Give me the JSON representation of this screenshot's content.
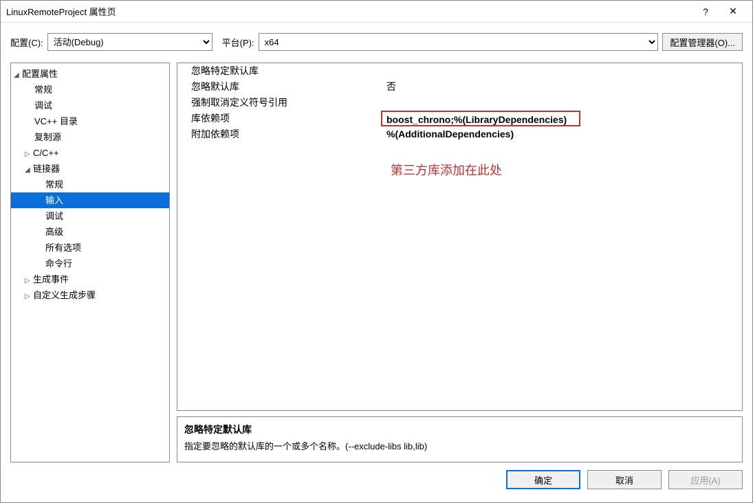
{
  "title": "LinuxRemoteProject 属性页",
  "toolbar": {
    "config_label": "配置(C):",
    "config_value": "活动(Debug)",
    "platform_label": "平台(P):",
    "platform_value": "x64",
    "manager_label": "配置管理器(O)..."
  },
  "tree": {
    "root": "配置属性",
    "items": [
      "常规",
      "调试",
      "VC++ 目录",
      "复制源"
    ],
    "cpp": "C/C++",
    "linker": "链接器",
    "linker_items": [
      "常规",
      "输入",
      "调试",
      "高级",
      "所有选项",
      "命令行"
    ],
    "build_events": "生成事件",
    "custom_build": "自定义生成步骤"
  },
  "props": [
    {
      "label": "忽略特定默认库",
      "value": ""
    },
    {
      "label": "忽略默认库",
      "value": "否"
    },
    {
      "label": "强制取消定义符号引用",
      "value": ""
    },
    {
      "label": "库依赖项",
      "value": "boost_chrono;%(LibraryDependencies)",
      "highlighted": true
    },
    {
      "label": "附加依赖项",
      "value": "%(AdditionalDependencies)"
    }
  ],
  "annotation": "第三方库添加在此处",
  "desc": {
    "title": "忽略特定默认库",
    "body": "指定要忽略的默认库的一个或多个名称。(--exclude-libs lib,lib)"
  },
  "footer": {
    "ok": "确定",
    "cancel": "取消",
    "apply": "应用(A)"
  }
}
